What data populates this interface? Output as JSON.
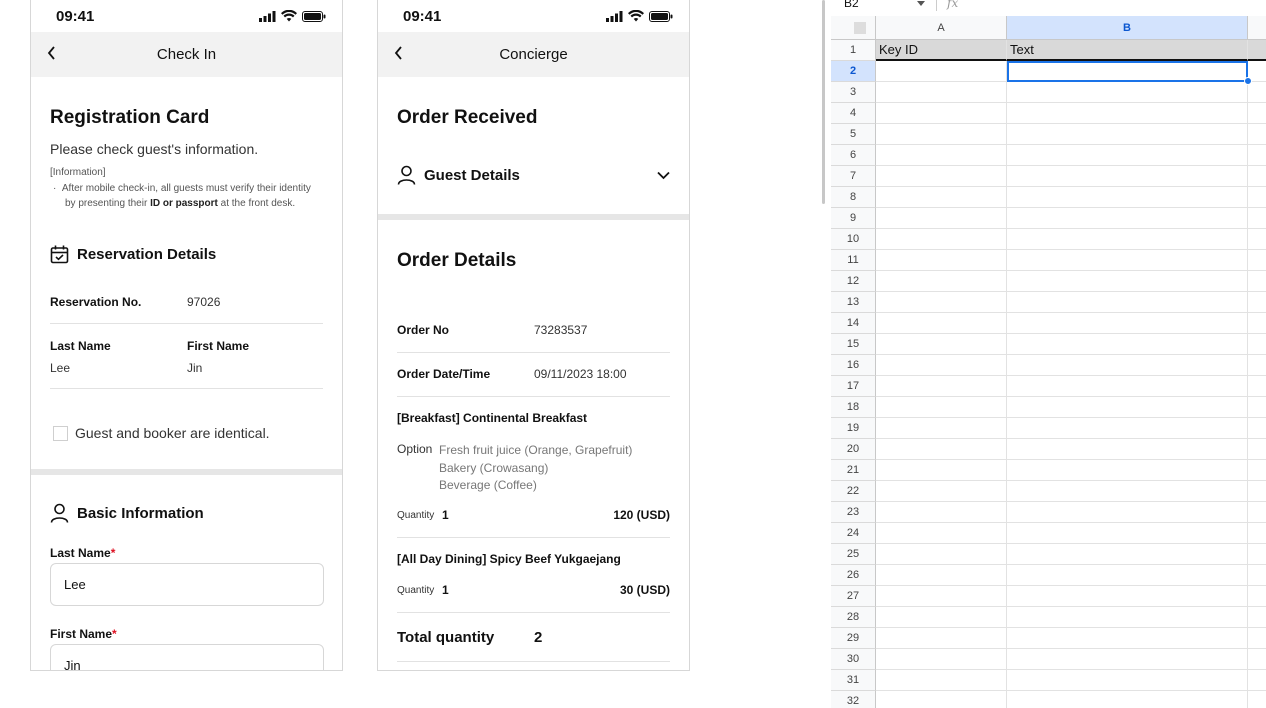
{
  "check_in": {
    "time": "09:41",
    "nav_title": "Check In",
    "title": "Registration Card",
    "subtitle": "Please check guest's information.",
    "info_heading": "[Information]",
    "info_part1": "After mobile check-in, all guests must verify their identity",
    "info_part2": "by presenting their",
    "info_bold": "ID or passport",
    "info_part3": "at the front desk.",
    "reservation_heading": "Reservation Details",
    "reservation_no_label": "Reservation No.",
    "reservation_no_value": "97026",
    "last_name_label": "Last Name",
    "last_name_value": "Lee",
    "first_name_label": "First Name",
    "first_name_value": "Jin",
    "identical_label": "Guest and booker are identical.",
    "basic_heading": "Basic Information",
    "form_last_label": "Last Name",
    "form_last_value": "Lee",
    "form_first_label": "First Name",
    "form_first_value": "Jin",
    "required_mark": "*"
  },
  "concierge": {
    "time": "09:41",
    "nav_title": "Concierge",
    "title": "Order Received",
    "guest_details": "Guest Details",
    "order_details": "Order Details",
    "order_no_label": "Order No",
    "order_no_value": "73283537",
    "order_dt_label": "Order Date/Time",
    "order_dt_value": "09/11/2023 18:00",
    "item1_name": "[Breakfast] Continental Breakfast",
    "option_label": "Option",
    "option_lines": [
      "Fresh fruit juice (Orange, Grapefruit)",
      "Bakery (Crowasang)",
      "Beverage (Coffee)"
    ],
    "quantity_label": "Quantity",
    "item1_qty": "1",
    "item1_price": "120 (USD)",
    "item2_name": "[All Day Dining] Spicy Beef Yukgaejang",
    "item2_qty": "1",
    "item2_price": "30 (USD)",
    "total_label": "Total quantity",
    "total_value": "2"
  },
  "sheet": {
    "name_box": "B2",
    "fx": "fx",
    "col_a": "A",
    "col_b": "B",
    "a1": "Key ID",
    "b1": "Text",
    "rows": [
      "1",
      "2",
      "3",
      "4",
      "5",
      "6",
      "7",
      "8",
      "9",
      "10",
      "11",
      "12",
      "13",
      "14",
      "15",
      "16",
      "17",
      "18",
      "19",
      "20",
      "21",
      "22",
      "23",
      "24",
      "25",
      "26",
      "27",
      "28",
      "29",
      "30",
      "31",
      "32"
    ],
    "accent": "#1a73e8"
  }
}
